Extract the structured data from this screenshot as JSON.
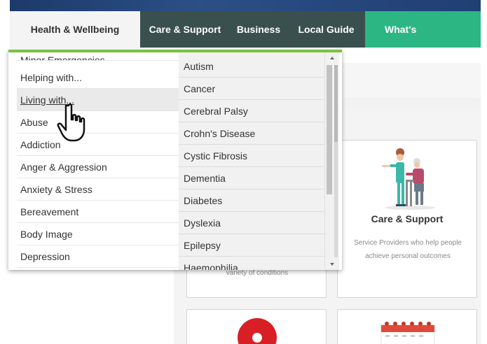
{
  "nav": {
    "items": [
      {
        "label": "Health & Wellbeing"
      },
      {
        "label": "Care & Support"
      },
      {
        "label": "Business"
      },
      {
        "label": "Local Guide"
      },
      {
        "label": "What's"
      }
    ]
  },
  "menu": {
    "left_items": [
      {
        "label": "Minor Emergencies"
      },
      {
        "label": "Helping with..."
      },
      {
        "label": "Living with..."
      },
      {
        "label": "Abuse"
      },
      {
        "label": "Addiction"
      },
      {
        "label": "Anger & Aggression"
      },
      {
        "label": "Anxiety & Stress"
      },
      {
        "label": "Bereavement"
      },
      {
        "label": "Body Image"
      },
      {
        "label": "Depression"
      }
    ],
    "right_items": [
      {
        "label": "Autism"
      },
      {
        "label": "Cancer"
      },
      {
        "label": "Cerebral Palsy"
      },
      {
        "label": "Crohn's Disease"
      },
      {
        "label": "Cystic Fibrosis"
      },
      {
        "label": "Dementia"
      },
      {
        "label": "Diabetes"
      },
      {
        "label": "Dyslexia"
      },
      {
        "label": "Epilepsy"
      },
      {
        "label": "Haemophilia"
      }
    ],
    "accent_color": "#7ac144"
  },
  "cards": {
    "card1": {
      "desc": "variety of conditions"
    },
    "card2": {
      "title": "Care & Support",
      "desc": "Service Providers who help people achieve personal outcomes"
    }
  },
  "colors": {
    "nav_bg": "#39504e",
    "nav_highlight": "#2cb684",
    "hero": "#2c4f86"
  },
  "icons": [
    "pointer-hand-icon",
    "care-support-illustration",
    "red-disc-icon",
    "calendar-icon"
  ]
}
